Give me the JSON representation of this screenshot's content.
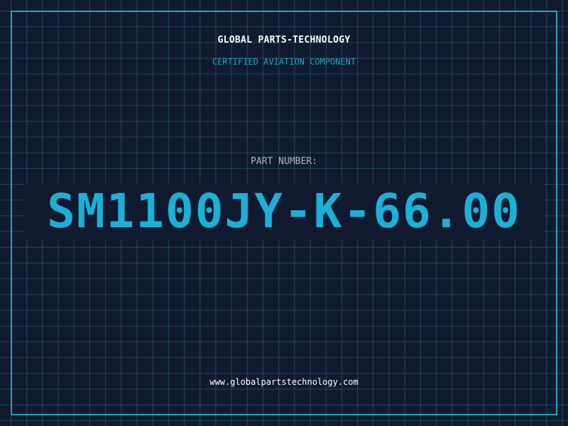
{
  "header": {
    "company": "GLOBAL PARTS-TECHNOLOGY",
    "subtitle": "CERTIFIED AVIATION COMPONENT"
  },
  "part": {
    "label": "PART NUMBER:",
    "number": "SM1100JY-K-66.00"
  },
  "footer": {
    "website": "www.globalpartstechnology.com"
  },
  "colors": {
    "background": "#111b2f",
    "accent": "#1ea3c9",
    "part_number": "#1cb0d8",
    "text": "#ffffff",
    "label": "#aab4c4"
  }
}
